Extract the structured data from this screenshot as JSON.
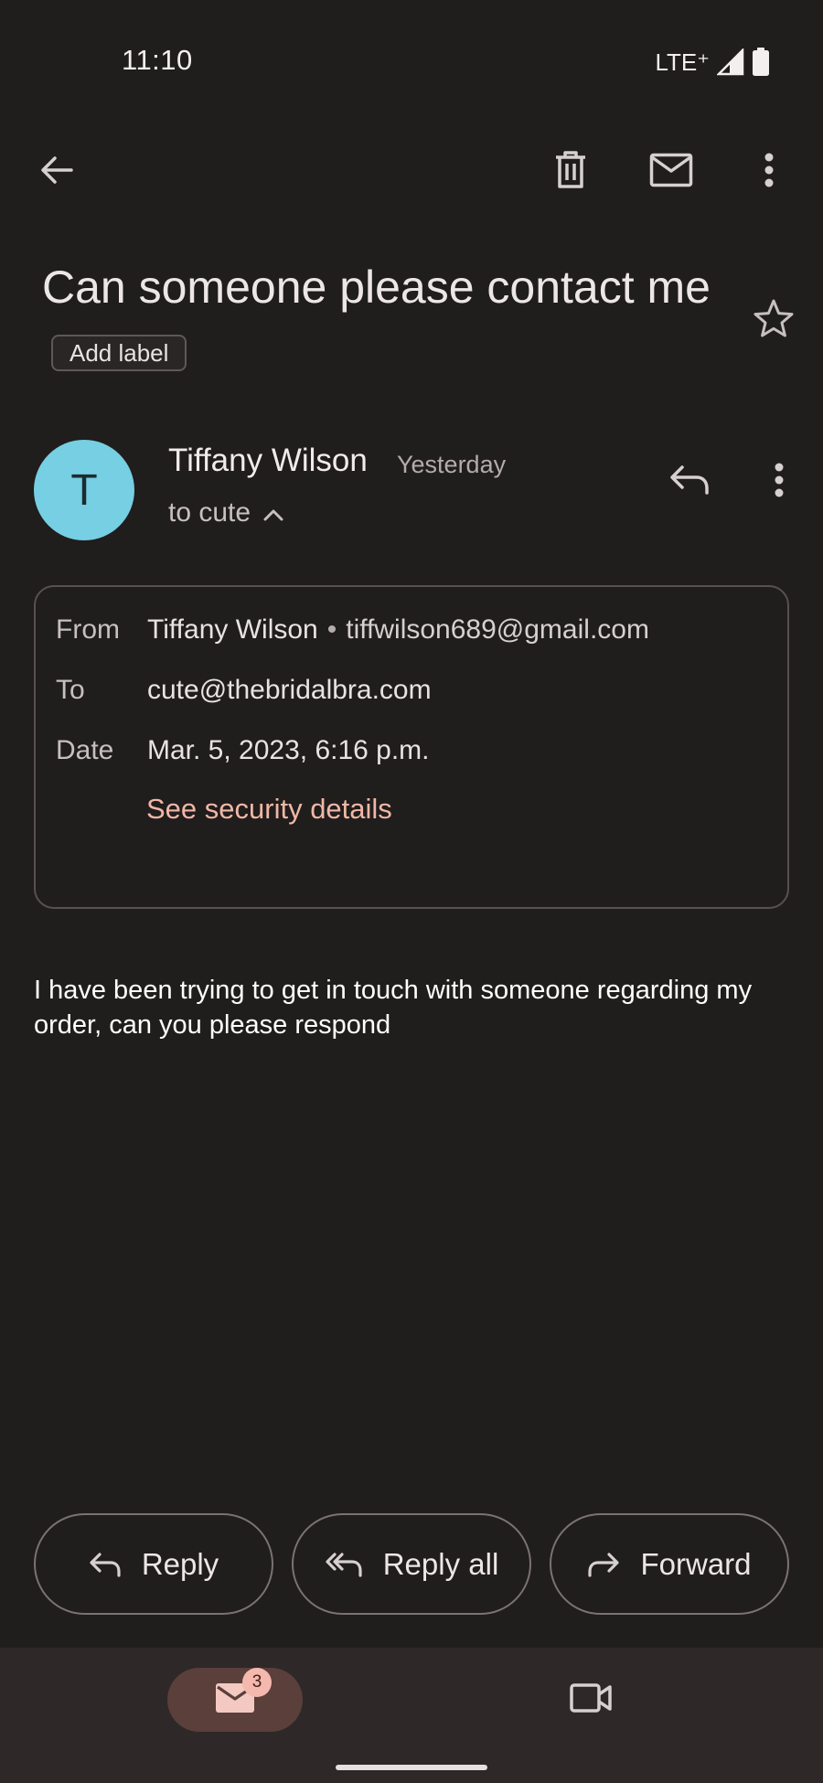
{
  "status_bar": {
    "time": "11:10",
    "network": "LTE⁺",
    "icons": [
      "signal-icon",
      "battery-icon"
    ]
  },
  "toolbar": {
    "icons": [
      "back-arrow-icon",
      "delete-icon",
      "mark-unread-icon",
      "more-vertical-icon"
    ]
  },
  "email": {
    "subject": "Can someone please contact me",
    "add_label": "Add label",
    "sender": {
      "initial": "T",
      "name": "Tiffany Wilson",
      "date": "Yesterday",
      "to_summary": "to cute",
      "avatar_color": "#76cfe2"
    },
    "details": {
      "from_label": "From",
      "from_name": "Tiffany Wilson",
      "separator": "•",
      "from_email": "tiffwilson689@gmail.com",
      "to_label": "To",
      "to_value": "cute@thebridalbra.com",
      "date_label": "Date",
      "date_value": "Mar. 5, 2023, 6:16 p.m.",
      "security_link": "See security details"
    },
    "body": "I have been trying to get in touch with someone regarding my order, can you please respond"
  },
  "actions": {
    "reply": "Reply",
    "reply_all": "Reply all",
    "forward": "Forward"
  },
  "bottom_nav": {
    "mail_badge": "3",
    "icons": [
      "mail-icon",
      "video-icon"
    ]
  },
  "colors": {
    "background": "#201d1d",
    "accent_link": "#f0b7a6",
    "nav_active": "#5a3f3b"
  }
}
